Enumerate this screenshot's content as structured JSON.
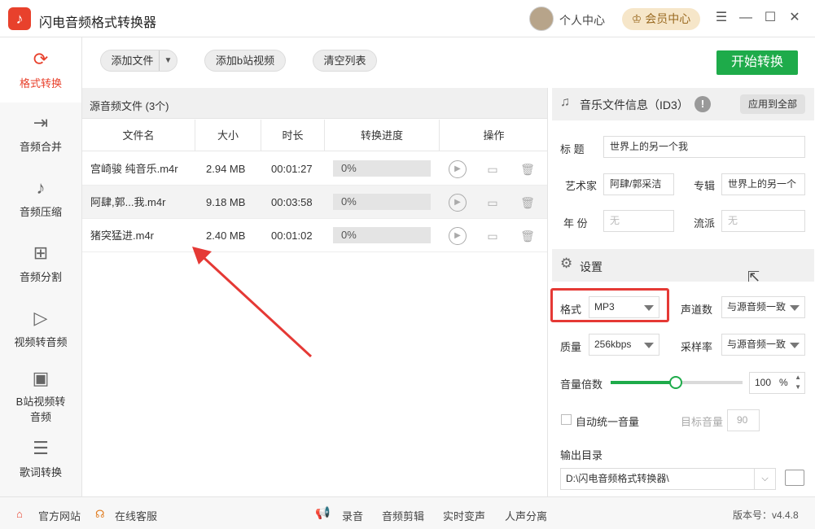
{
  "app": {
    "title": "闪电音频格式转换器",
    "logo_glyph": "♪"
  },
  "header": {
    "personal_center": "个人中心",
    "member_center": "会员中心",
    "menu_glyph": "☰",
    "min_glyph": "—",
    "max_glyph": "☐",
    "close_glyph": "✕"
  },
  "sidebar": {
    "items": [
      {
        "label": "格式转换",
        "icon": "refresh-icon",
        "glyph": "⟳"
      },
      {
        "label": "音频合并",
        "icon": "merge-icon",
        "glyph": "⇥"
      },
      {
        "label": "音频压缩",
        "icon": "music-note-icon",
        "glyph": "♪"
      },
      {
        "label": "音频分割",
        "icon": "split-icon",
        "glyph": "⊞"
      },
      {
        "label": "视频转音频",
        "icon": "video-icon",
        "glyph": "▷"
      },
      {
        "label": "B站视频转音频",
        "icon": "bilibili-icon",
        "glyph": "▣"
      },
      {
        "label": "歌词转换",
        "icon": "lyrics-icon",
        "glyph": "☰"
      }
    ]
  },
  "toolbar": {
    "add_file": "添加文件",
    "add_bilibili": "添加b站视频",
    "clear_list": "清空列表",
    "start": "开始转换"
  },
  "file_list": {
    "title": "源音频文件 (3个)",
    "columns": [
      "文件名",
      "大小",
      "时长",
      "转换进度",
      "操作"
    ],
    "rows": [
      {
        "name": "宫崎骏 纯音乐.m4r",
        "size": "2.94 MB",
        "duration": "00:01:27",
        "progress": "0%"
      },
      {
        "name": "阿肆,郭...我.m4r",
        "size": "9.18 MB",
        "duration": "00:03:58",
        "progress": "0%"
      },
      {
        "name": "猪突猛进.m4r",
        "size": "2.40 MB",
        "duration": "00:01:02",
        "progress": "0%"
      }
    ],
    "op_glyphs": {
      "play": "▶",
      "folder": "▭",
      "delete": "🗑"
    }
  },
  "id3": {
    "title": "音乐文件信息（ID3）",
    "apply_all": "应用到全部",
    "title_label": "标  题",
    "title_value": "世界上的另一个我",
    "artist_label": "艺术家",
    "artist_value": "阿肆/郭采洁",
    "album_label": "专辑",
    "album_value": "世界上的另一个",
    "year_label": "年  份",
    "year_placeholder": "无",
    "genre_label": "流派",
    "genre_placeholder": "无"
  },
  "settings": {
    "title": "设置",
    "format_label": "格式",
    "format_value": "MP3",
    "channels_label": "声道数",
    "channels_value": "与源音频一致",
    "quality_label": "质量",
    "quality_value": "256kbps",
    "sample_label": "采样率",
    "sample_value": "与源音频一致",
    "volume_label": "音量倍数",
    "volume_value": "100",
    "volume_unit": "%",
    "volume_level": 0.5,
    "auto_volume_label": "自动统一音量",
    "target_volume_label": "目标音量",
    "target_volume_value": "90",
    "output_label": "输出目录",
    "output_value": "D:\\闪电音频格式转换器\\"
  },
  "footer": {
    "website": "官方网站",
    "support": "在线客服",
    "record": "录音",
    "edit": "音频剪辑",
    "voice_change": "实时变声",
    "vocal_split": "人声分离",
    "version": "版本号：v4.4.8"
  },
  "colors": {
    "accent": "#e8412c",
    "start_green": "#1eab4a",
    "highlight_red": "#e53935"
  }
}
